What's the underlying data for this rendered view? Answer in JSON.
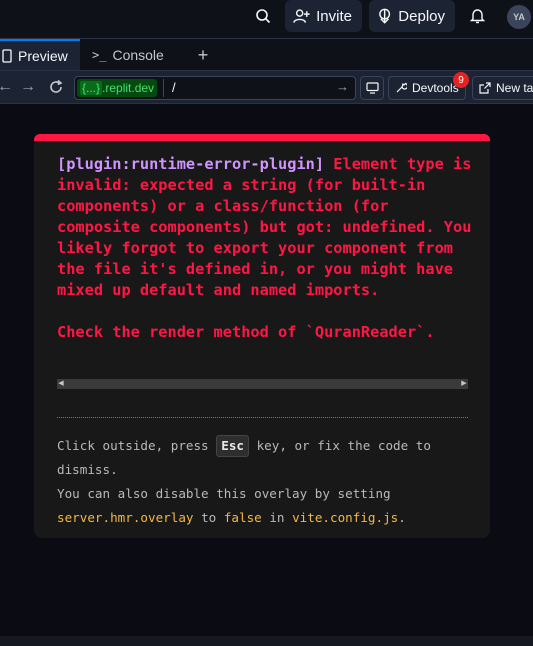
{
  "header": {
    "invite_label": "Invite",
    "deploy_label": "Deploy",
    "avatar_initials": "YA"
  },
  "tabs": {
    "preview_label": "Preview",
    "console_label": "Console",
    "add_label": "+"
  },
  "urlbar": {
    "domain_badge": "{...}",
    "domain": ".replit.dev",
    "path": "/",
    "devtools_label": "Devtools",
    "devtools_badge": "9",
    "new_tab_label": "New ta"
  },
  "overlay": {
    "plugin": "[plugin:runtime-error-plugin]",
    "message": " Element type is invalid: expected a string (for built-in components) or a class/function (for composite components) but got: undefined. You likely forgot to export your component from the file it's defined in, or you might have mixed up default and named imports.\n\nCheck the render method of `QuranReader`.",
    "tip_line1_a": "Click outside, press ",
    "tip_key": "Esc",
    "tip_line1_b": " key, or fix the code to dismiss.",
    "tip_line2_a": "You can also disable this overlay by setting ",
    "tip_code1": "server.hmr.overlay",
    "tip_line2_b": " to ",
    "tip_code2": "false",
    "tip_line2_c": " in ",
    "tip_code3": "vite.config.js",
    "tip_line2_d": "."
  },
  "colors": {
    "error": "#ff1744",
    "plugin": "#cf94ff",
    "code": "#f5b844"
  }
}
